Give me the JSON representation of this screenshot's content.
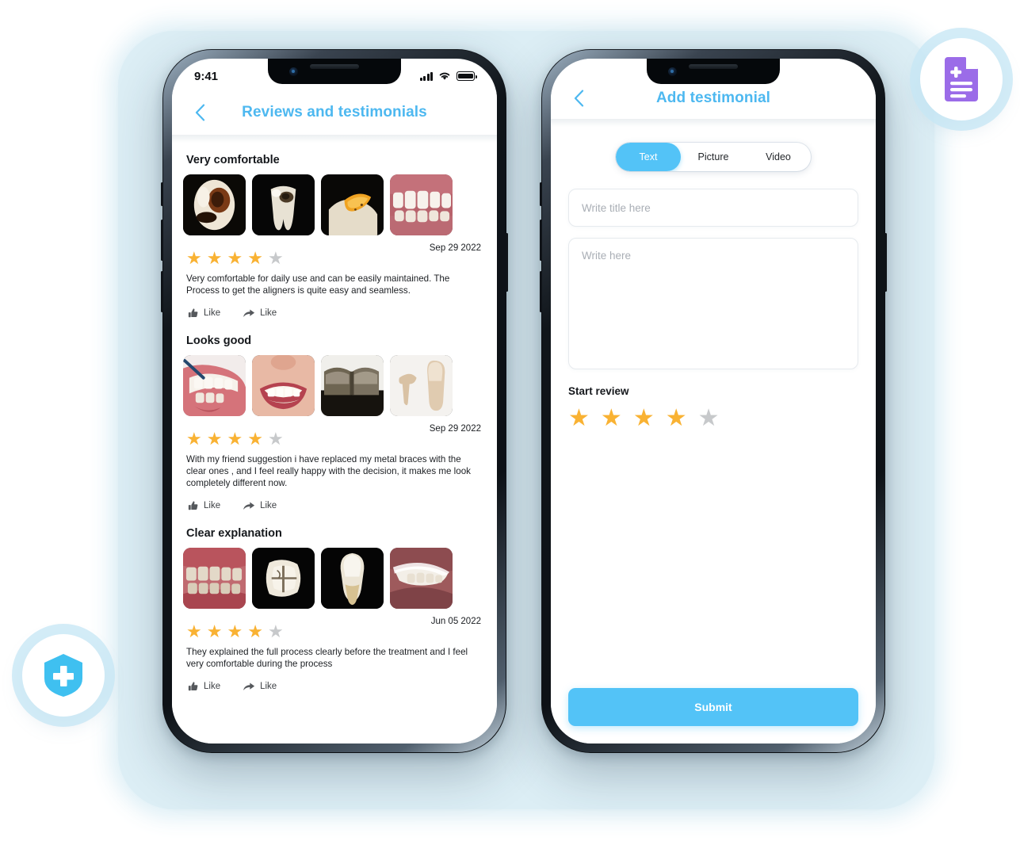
{
  "theme": {
    "accent_blue": "#4DB8F0",
    "button_blue": "#53C3F7",
    "star_gold": "#F9B233",
    "star_gray": "#C7C9CB",
    "backdrop_blue": "#DCEEF5",
    "badge_purple": "#9B6CE8"
  },
  "phone_left": {
    "status_bar": {
      "time": "9:41",
      "signal": "signal-bars-icon",
      "wifi": "wifi-icon",
      "battery": "battery-icon"
    },
    "header": {
      "back": "back-chevron-icon",
      "title": "Reviews and testimonials"
    },
    "reviews": [
      {
        "title": "Very comfortable",
        "date": "Sep 29 2022",
        "rating": 4,
        "max_rating": 5,
        "body": "Very comfortable for daily use and can be easily maintained.  The Process to get the aligners is quite easy and seamless.",
        "actions": [
          {
            "icon": "thumbs-up-icon",
            "label": "Like"
          },
          {
            "icon": "share-arrow-icon",
            "label": "Like"
          }
        ],
        "thumbnails": [
          "decayed-tooth-dark",
          "molar-cavity-dark",
          "tooth-orange-stain",
          "upper-teeth-gums"
        ]
      },
      {
        "title": "Looks good",
        "date": "Sep 29 2022",
        "rating": 4,
        "max_rating": 5,
        "body": "With my friend suggestion i have replaced my metal braces with the clear ones , and I feel really happy with the decision, it makes me look completely different now.",
        "actions": [
          {
            "icon": "thumbs-up-icon",
            "label": "Like"
          },
          {
            "icon": "share-arrow-icon",
            "label": "Like"
          }
        ],
        "thumbnails": [
          "dental-probe-exam",
          "smiling-mouth",
          "dark-molars-row",
          "tooth-implant-white"
        ]
      },
      {
        "title": "Clear explanation",
        "date": "Jun 05 2022",
        "rating": 4,
        "max_rating": 5,
        "body": "They explained the full process clearly before the treatment and I feel very comfortable during the process",
        "actions": [
          {
            "icon": "thumbs-up-icon",
            "label": "Like"
          },
          {
            "icon": "share-arrow-icon",
            "label": "Like"
          }
        ],
        "thumbnails": [
          "side-bite-teeth",
          "molar-top-view",
          "single-tooth-root",
          "mouth-with-retainer"
        ]
      }
    ]
  },
  "phone_right": {
    "header": {
      "back": "back-chevron-icon",
      "title": "Add testimonial"
    },
    "tabs": [
      {
        "label": "Text",
        "active": true
      },
      {
        "label": "Picture",
        "active": false
      },
      {
        "label": "Video",
        "active": false
      }
    ],
    "form": {
      "title_input": {
        "value": "",
        "placeholder": "Write title here"
      },
      "body_input": {
        "value": "",
        "placeholder": "Write here"
      },
      "rating_label": "Start review",
      "rating": 4,
      "max_rating": 5
    },
    "submit_label": "Submit"
  },
  "badges": [
    {
      "name": "medical-document-icon",
      "color": "#9B6CE8",
      "position": "top-right"
    },
    {
      "name": "medical-shield-icon",
      "color": "#3FC0F0",
      "position": "bottom-left"
    }
  ]
}
